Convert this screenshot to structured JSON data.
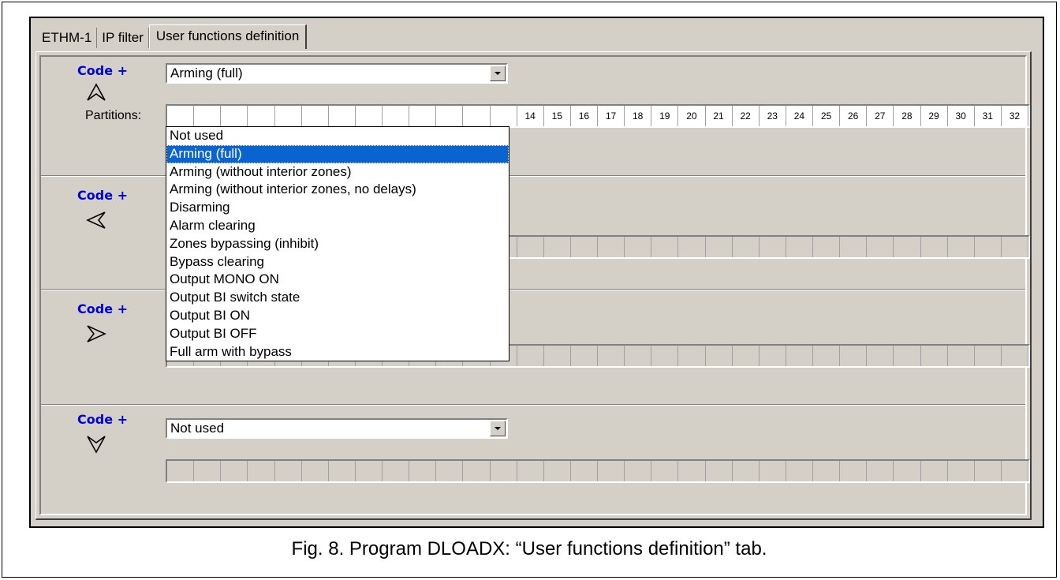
{
  "tabs": [
    "ETHM-1",
    "IP filter",
    "User functions definition"
  ],
  "code_label": "Code +",
  "partitions_label": "Partitions:",
  "functions": [
    {
      "arrow": "up-arrow-icon",
      "selected": "Arming (full)"
    },
    {
      "arrow": "left-arrow-icon",
      "selected": ""
    },
    {
      "arrow": "right-arrow-icon",
      "selected": ""
    },
    {
      "arrow": "down-arrow-icon",
      "selected": "Not used"
    }
  ],
  "partition_numbers": [
    "14",
    "15",
    "16",
    "17",
    "18",
    "19",
    "20",
    "21",
    "22",
    "23",
    "24",
    "25",
    "26",
    "27",
    "28",
    "29",
    "30",
    "31",
    "32"
  ],
  "dropdown": {
    "selected_index": 1,
    "options": [
      "Not used",
      "Arming (full)",
      "Arming (without interior zones)",
      "Arming (without interior zones, no delays)",
      "Disarming",
      "Alarm clearing",
      "Zones bypassing (inhibit)",
      "Bypass clearing",
      "Output MONO ON",
      "Output BI switch state",
      "Output BI ON",
      "Output BI OFF",
      "Full arm with bypass"
    ]
  },
  "caption": "Fig. 8. Program DLOADX: “User functions definition” tab."
}
